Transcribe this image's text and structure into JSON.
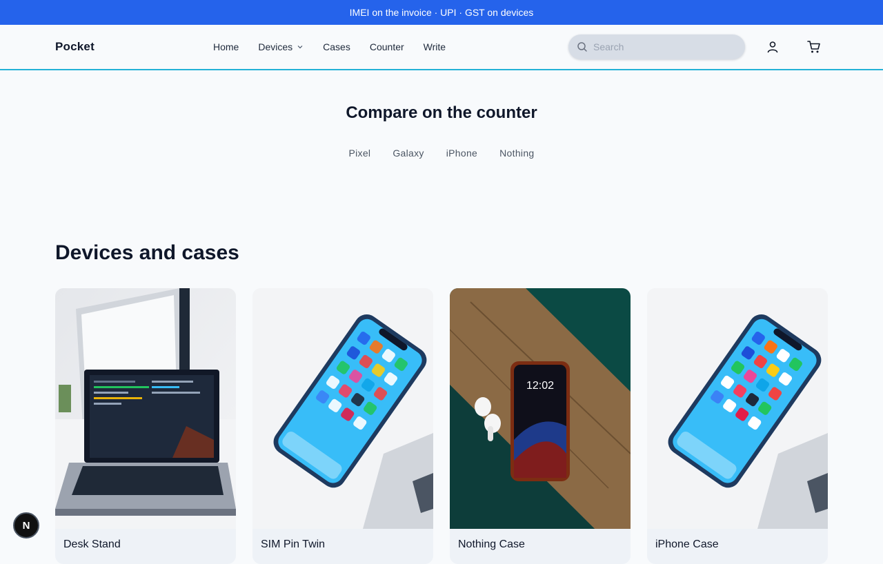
{
  "promo": {
    "text": "IMEI on the invoice · UPI · GST on devices"
  },
  "header": {
    "logo": "Pocket",
    "nav": [
      {
        "label": "Home"
      },
      {
        "label": "Devices",
        "has_dropdown": true
      },
      {
        "label": "Cases"
      },
      {
        "label": "Counter"
      },
      {
        "label": "Write"
      }
    ],
    "search": {
      "placeholder": "Search",
      "value": ""
    },
    "icons": [
      "search-icon",
      "user-icon",
      "cart-icon"
    ]
  },
  "compare": {
    "title": "Compare on the counter",
    "brands": [
      "Pixel",
      "Galaxy",
      "iPhone",
      "Nothing"
    ]
  },
  "products": {
    "title": "Devices and cases",
    "items": [
      {
        "name": "Desk Stand",
        "image": "laptop-on-desk"
      },
      {
        "name": "SIM Pin Twin",
        "image": "iphone-homescreen"
      },
      {
        "name": "Nothing Case",
        "image": "iphone-on-wood"
      },
      {
        "name": "iPhone Case",
        "image": "iphone-homescreen"
      }
    ]
  },
  "fab": {
    "label": "N"
  },
  "colors": {
    "promo_bg": "#2563eb",
    "header_border": "#22b1d6",
    "page_bg": "#f8fafc",
    "text": "#0f172a"
  }
}
